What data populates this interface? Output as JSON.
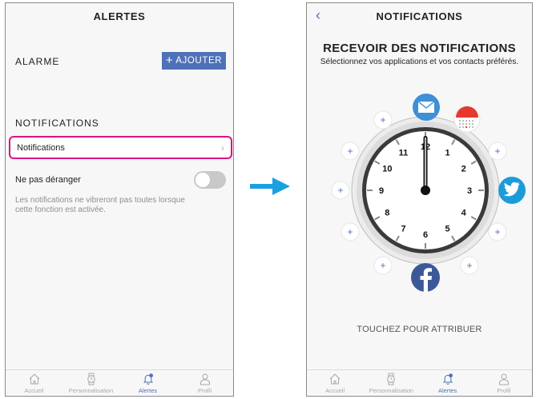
{
  "left_screen": {
    "title": "ALERTES",
    "alarm_label": "ALARME",
    "add_button": "AJOUTER",
    "notifications_section": "NOTIFICATIONS",
    "notifications_row": "Notifications",
    "dnd_label": "Ne pas déranger",
    "dnd_enabled": false,
    "dnd_description": "Les notifications ne vibreront pas toutes lorsque cette fonction est activée."
  },
  "right_screen": {
    "title": "NOTIFICATIONS",
    "heading": "RECEVOIR DES NOTIFICATIONS",
    "subheading": "Sélectionnez vos applications et vos contacts préférés.",
    "assign_label": "TOUCHEZ POUR ATTRIBUER",
    "clock_numbers": [
      "12",
      "1",
      "2",
      "3",
      "4",
      "5",
      "6",
      "7",
      "8",
      "9",
      "10",
      "11"
    ],
    "assigned_apps": [
      "email-icon",
      "calendar-icon",
      "twitter-icon",
      "facebook-icon"
    ],
    "add_slot_symbol": "+"
  },
  "tabbar": {
    "tabs": [
      "Accueil",
      "Personnalisation",
      "Alertes",
      "Profil"
    ],
    "active_tab": "Alertes"
  },
  "colors": {
    "accent": "#4f71b8",
    "highlight": "#d8157f",
    "arrow": "#1aa0e0",
    "email": "#3d8fd6",
    "twitter": "#1d9bd8",
    "facebook": "#3b5998"
  }
}
